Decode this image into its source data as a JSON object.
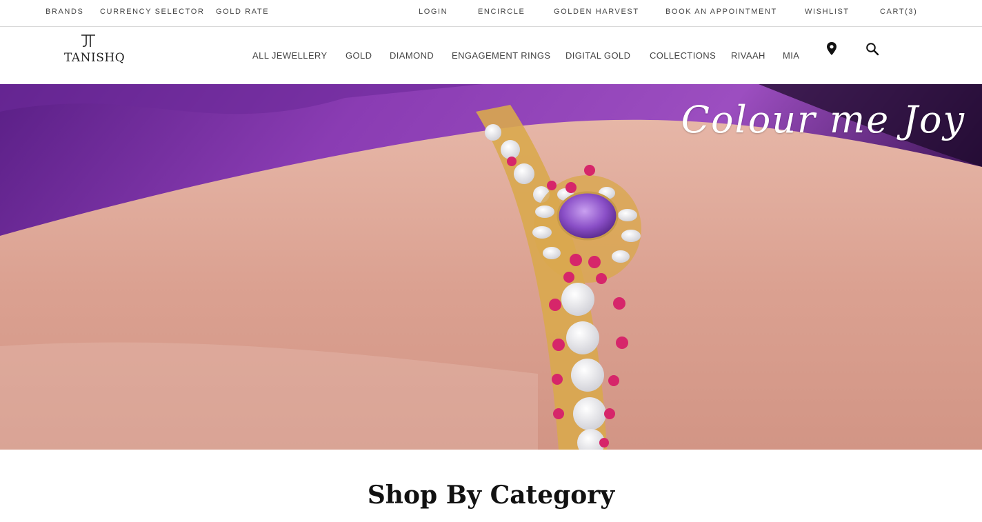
{
  "topbar": {
    "left": [
      "BRANDS",
      "CURRENCY SELECTOR",
      "GOLD RATE"
    ],
    "right": [
      "LOGIN",
      "ENCIRCLE",
      "GOLDEN HARVEST",
      "BOOK AN APPOINTMENT",
      "WISHLIST",
      "CART(3)"
    ]
  },
  "logo": {
    "text": "TANISHQ"
  },
  "nav": [
    "ALL JEWELLERY",
    "GOLD",
    "DIAMOND",
    "ENGAGEMENT RINGS",
    "DIGITAL GOLD",
    "COLLECTIONS",
    "RIVAAH",
    "MIA"
  ],
  "icons": {
    "location": "map-pin-icon",
    "search": "search-icon"
  },
  "hero": {
    "tagline": "Colour me Joy"
  },
  "section": {
    "title": "Shop By Category"
  },
  "colors": {
    "accent_purple": "#7b2fa0",
    "skin": "#dba79a",
    "ruby": "#d6266a",
    "gold": "#d9a84e"
  }
}
